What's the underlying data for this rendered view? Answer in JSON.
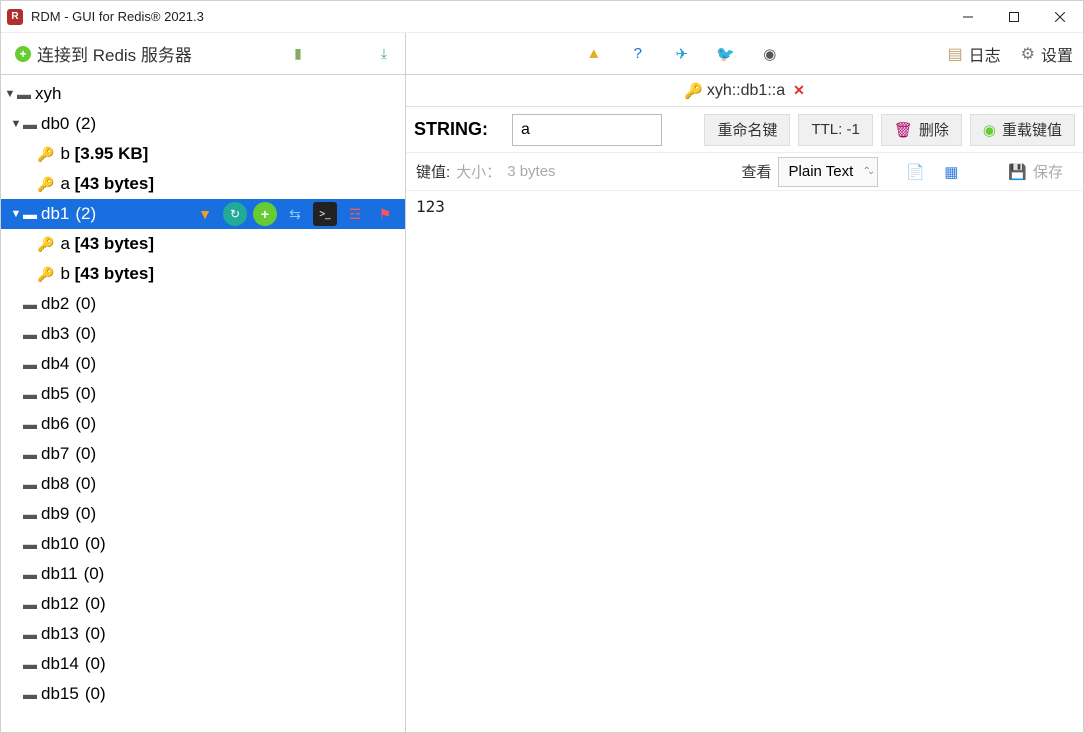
{
  "title": "RDM - GUI for Redis® 2021.3",
  "toolbar": {
    "connect_label": "连接到 Redis 服务器",
    "log_label": "日志",
    "settings_label": "设置"
  },
  "tree": {
    "server_name": "xyh",
    "db0": {
      "name": "db0",
      "count": "(2)"
    },
    "db0_keys": [
      {
        "name": "b",
        "meta": "[3.95 KB]"
      },
      {
        "name": "a",
        "meta": "[43 bytes]"
      }
    ],
    "db1": {
      "name": "db1",
      "count": "(2)"
    },
    "db1_keys": [
      {
        "name": "a",
        "meta": "[43 bytes]"
      },
      {
        "name": "b",
        "meta": "[43 bytes]"
      }
    ],
    "empty_dbs": [
      {
        "name": "db2",
        "count": "(0)"
      },
      {
        "name": "db3",
        "count": "(0)"
      },
      {
        "name": "db4",
        "count": "(0)"
      },
      {
        "name": "db5",
        "count": "(0)"
      },
      {
        "name": "db6",
        "count": "(0)"
      },
      {
        "name": "db7",
        "count": "(0)"
      },
      {
        "name": "db8",
        "count": "(0)"
      },
      {
        "name": "db9",
        "count": "(0)"
      },
      {
        "name": "db10",
        "count": "(0)"
      },
      {
        "name": "db11",
        "count": "(0)"
      },
      {
        "name": "db12",
        "count": "(0)"
      },
      {
        "name": "db13",
        "count": "(0)"
      },
      {
        "name": "db14",
        "count": "(0)"
      },
      {
        "name": "db15",
        "count": "(0)"
      }
    ]
  },
  "tab": {
    "title": "xyh::db1::a"
  },
  "key": {
    "type_label": "STRING:",
    "name_value": "a",
    "rename_btn": "重命名键",
    "ttl_btn": "TTL:  -1",
    "delete_btn": "删除",
    "reload_btn": "重载键值"
  },
  "value_header": {
    "label": "键值:",
    "size_hint_label": "大小：",
    "size_hint_value": "3 bytes",
    "view_label": "查看",
    "view_mode": "Plain Text",
    "save_label": "保存"
  },
  "value_body": "123"
}
